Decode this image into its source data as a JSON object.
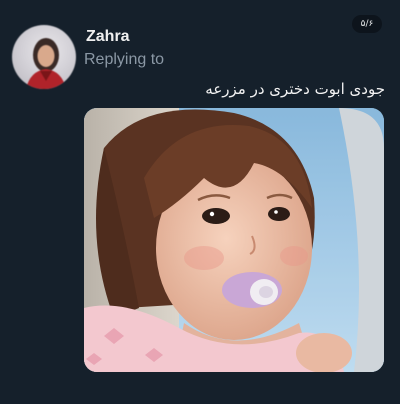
{
  "post": {
    "author_name": "Zahra",
    "reply_context": "Replying to",
    "text": "جودی ابوت دختری در مزرعه",
    "page_counter": "۵/۶"
  },
  "media": {
    "kind": "photo",
    "subject": "toddler with pacifier by airplane window"
  },
  "colors": {
    "background": "#15202b",
    "primary_text": "#e7e9ea",
    "secondary_text": "#8b98a5"
  }
}
